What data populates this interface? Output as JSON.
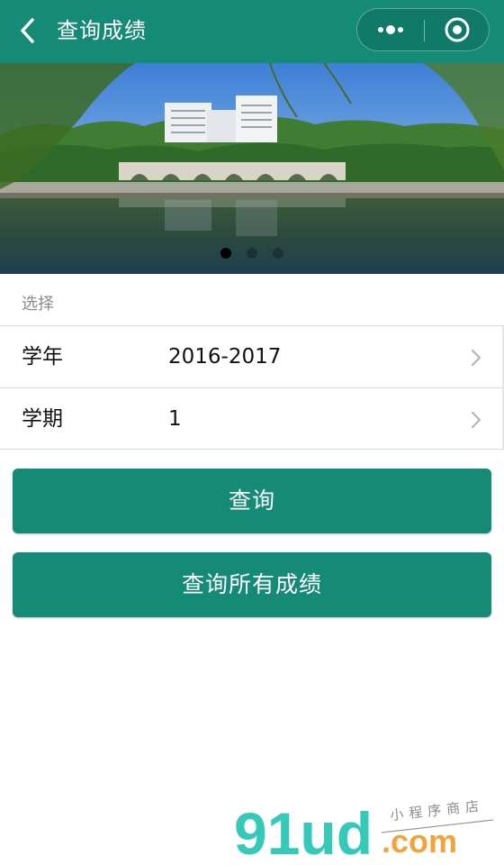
{
  "nav": {
    "title": "查询成绩",
    "back_icon": "chevron-left-icon",
    "more_icon": "ellipsis-icon",
    "close_icon": "target-icon",
    "background": "#148a77"
  },
  "banner": {
    "slide_count": 3,
    "active_slide": 1
  },
  "form": {
    "section_label": "选择",
    "rows": [
      {
        "label": "学年",
        "value": "2016-2017"
      },
      {
        "label": "学期",
        "value": "1"
      }
    ]
  },
  "buttons": {
    "query_label": "查询",
    "query_all_label": "查询所有成绩",
    "color": "#148a77"
  },
  "watermark": {
    "brand": "91ud",
    "domain": ".com",
    "tagline": "小程序商店"
  }
}
